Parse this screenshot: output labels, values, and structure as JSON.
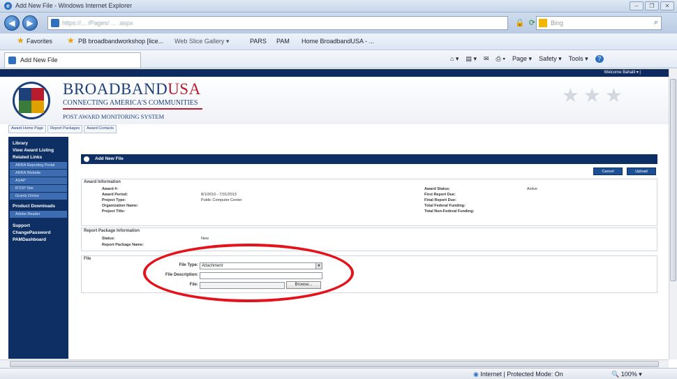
{
  "window": {
    "title": "Add New File - Windows Internet Explorer"
  },
  "address": {
    "url": "https://... /Pages/ ... .aspx",
    "search_placeholder": "Bing"
  },
  "favorites_bar": {
    "favorites_label": "Favorites",
    "items": [
      "PB broadbandworkshop [lice...",
      "Web Slice Gallery ▾",
      "PARS",
      "PAM",
      "Home BroadbandUSA - ..."
    ]
  },
  "tab": {
    "label": "Add New File"
  },
  "commands": {
    "page": "Page ▾",
    "safety": "Safety ▾",
    "tools": "Tools ▾",
    "help": "?"
  },
  "page": {
    "welcome": "Welcome Bahalil ▾ |",
    "brand_main": "BROADBAND",
    "brand_accent": "USA",
    "tagline": "CONNECTING AMERICA'S COMMUNITIES",
    "system_name": "POST AWARD MONITORING SYSTEM",
    "top_nav": [
      "Award Home Page",
      "Report Packages",
      "Award Contacts"
    ],
    "sidebar": {
      "library": "Library",
      "view_award_listing": "View Award Listing",
      "related_links": "Related Links",
      "related_items": [
        "ARRA Reporting Portal",
        "ARRA Website",
        "ASAP",
        "BTOP Site",
        "Grants Online"
      ],
      "product_downloads": "Product Downloads",
      "downloads_items": [
        "Adobe Reader"
      ],
      "support": "Support",
      "change_password": "ChangePassword",
      "pam_dashboard": "PAMDashboard"
    },
    "section_title": "Add New File",
    "buttons": {
      "cancel": "Cancel",
      "upload": "Upload"
    },
    "award_info": {
      "title": "Award Information",
      "award_num_label": "Award #:",
      "award_period_label": "Award Period:",
      "award_period": "8/1/2010 - 7/31/2013",
      "project_type_label": "Project Type:",
      "project_type": "Public Computer Center",
      "org_name_label": "Organization Name:",
      "project_title_label": "Project Title:",
      "award_status_label": "Award Status:",
      "award_status": "Active",
      "first_report_label": "First Report Due:",
      "final_report_label": "Final Report Due:",
      "total_fed_label": "Total Federal Funding:",
      "total_nonfed_label": "Total Non-Federal Funding:"
    },
    "report_pkg": {
      "title": "Report Package Information",
      "status_label": "Status:",
      "status": "New",
      "name_label": "Report Package Name:"
    },
    "file": {
      "title": "File",
      "type_label": "File Type:",
      "type_value": "Attachment",
      "desc_label": "File Description:",
      "file_label": "File:",
      "browse": "Browse..."
    }
  },
  "status": {
    "zone": "Internet | Protected Mode: On",
    "zoom": "100%"
  }
}
